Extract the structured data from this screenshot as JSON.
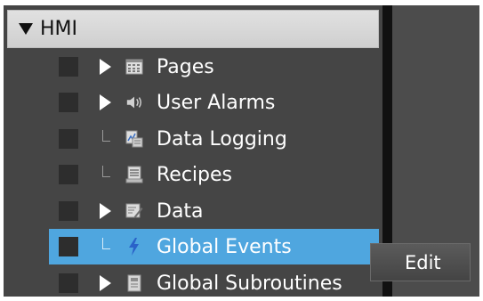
{
  "tree": {
    "root_label": "HMI",
    "items": [
      {
        "label": "Pages",
        "icon": "pages-icon",
        "expandable": true,
        "selected": false
      },
      {
        "label": "User Alarms",
        "icon": "speaker-icon",
        "expandable": true,
        "selected": false
      },
      {
        "label": "Data Logging",
        "icon": "data-logging-icon",
        "expandable": false,
        "selected": false
      },
      {
        "label": "Recipes",
        "icon": "recipes-icon",
        "expandable": false,
        "selected": false
      },
      {
        "label": "Data",
        "icon": "data-edit-icon",
        "expandable": true,
        "selected": false
      },
      {
        "label": "Global Events",
        "icon": "lightning-icon",
        "expandable": false,
        "selected": true
      },
      {
        "label": "Global Subroutines",
        "icon": "subroutine-icon",
        "expandable": true,
        "selected": false
      }
    ]
  },
  "context_menu": {
    "items": [
      "Edit"
    ]
  },
  "colors": {
    "panel_bg": "#454545",
    "selection": "#4fa6df",
    "lightning": "#2a62c9"
  }
}
